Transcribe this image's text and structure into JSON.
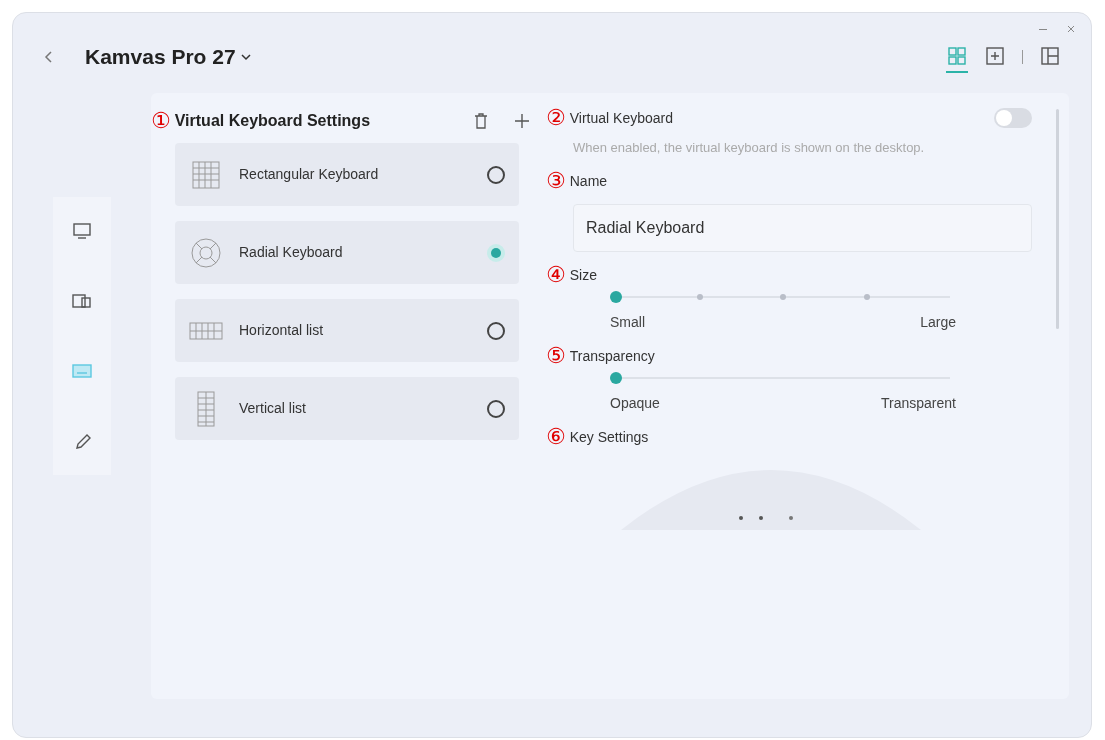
{
  "window": {
    "title": "Kamvas Pro 27"
  },
  "view_tabs": [
    {
      "selected": true
    },
    {
      "selected": false
    },
    {
      "selected": false
    }
  ],
  "sidebar": {
    "items": [
      {
        "selected": false
      },
      {
        "selected": false
      },
      {
        "selected": true
      },
      {
        "selected": false
      }
    ]
  },
  "keyboard_list": {
    "marker": "①",
    "title": "Virtual Keyboard Settings",
    "items": [
      {
        "kind": "rectangular",
        "label": "Rectangular Keyboard",
        "selected": false
      },
      {
        "kind": "radial",
        "label": "Radial Keyboard",
        "selected": true
      },
      {
        "kind": "horizontal",
        "label": "Horizontal list",
        "selected": false
      },
      {
        "kind": "vertical",
        "label": "Vertical list",
        "selected": false
      }
    ]
  },
  "settings": {
    "virtual_keyboard": {
      "marker": "②",
      "label": "Virtual Keyboard",
      "on": false,
      "description": "When enabled, the virtual keyboard is shown on the desktop."
    },
    "name": {
      "marker": "③",
      "label": "Name",
      "value": "Radial Keyboard"
    },
    "sliders": [
      {
        "marker": "④",
        "label": "Size",
        "level": 0,
        "steps": true,
        "min_label": "Small",
        "max_label": "Large"
      },
      {
        "marker": "⑤",
        "label": "Transparency",
        "level": 0,
        "steps": false,
        "min_label": "Opaque",
        "max_label": "Transparent"
      }
    ],
    "key_settings": {
      "marker": "⑥",
      "label": "Key Settings"
    }
  }
}
